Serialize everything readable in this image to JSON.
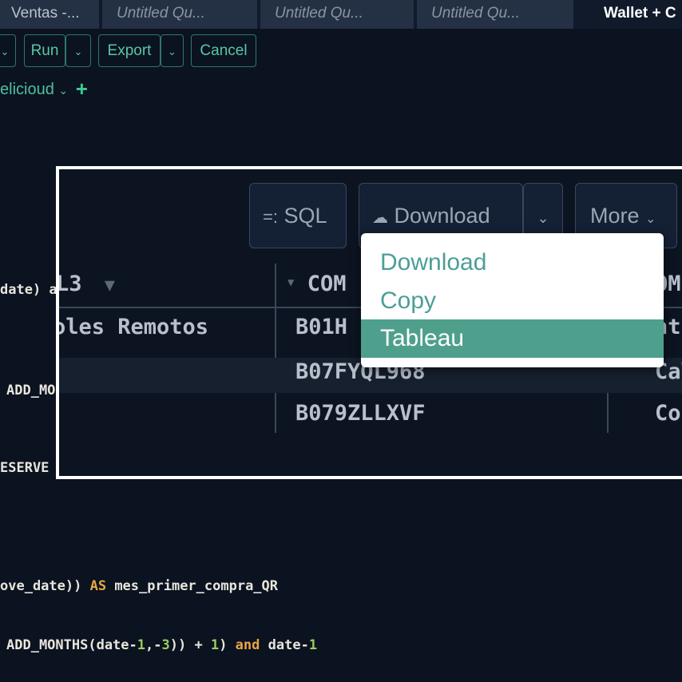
{
  "tabs": [
    {
      "label": "Ventas -..."
    },
    {
      "label": "Untitled Qu..."
    },
    {
      "label": "Untitled Qu..."
    },
    {
      "label": "Untitled Qu..."
    },
    {
      "label": "Wallet + C"
    }
  ],
  "toolbar": {
    "run_label": "Run",
    "export_label": "Export",
    "cancel_label": "Cancel"
  },
  "connection": {
    "name": "elicioud"
  },
  "code_lines": {
    "line1": "date) a",
    "line2": "ADD_MO",
    "line3": "ESERVE",
    "line4_a": "ove_date)) ",
    "line4_kw": "AS",
    "line4_b": " mes_primer_compra_QR",
    "line5_a": "ADD_MONTHS(date-",
    "line5_n1": "1",
    "line5_c": ",-",
    "line5_n2": "3",
    "line5_d": ")) + ",
    "line5_n3": "1",
    "line5_e": ") ",
    "line5_kw": "and",
    "line5_f": " date-",
    "line5_n4": "1"
  },
  "results": {
    "sql_button": "SQL",
    "download_button": "Download",
    "more_button": "More",
    "columns": [
      "L3",
      "COM",
      "OM"
    ],
    "rows": [
      [
        "oles Remotos",
        "B01H",
        "nt"
      ],
      [
        "",
        "B07FYQL968",
        "Calg"
      ],
      [
        "",
        "B079ZLLXVF",
        "Cons"
      ]
    ]
  },
  "download_menu": {
    "items": [
      "Download",
      "Copy",
      "Tableau"
    ],
    "highlighted": "Tableau"
  },
  "colors": {
    "accent": "#58c8a4",
    "highlight": "#4e9f8c",
    "background": "#0b1220"
  }
}
